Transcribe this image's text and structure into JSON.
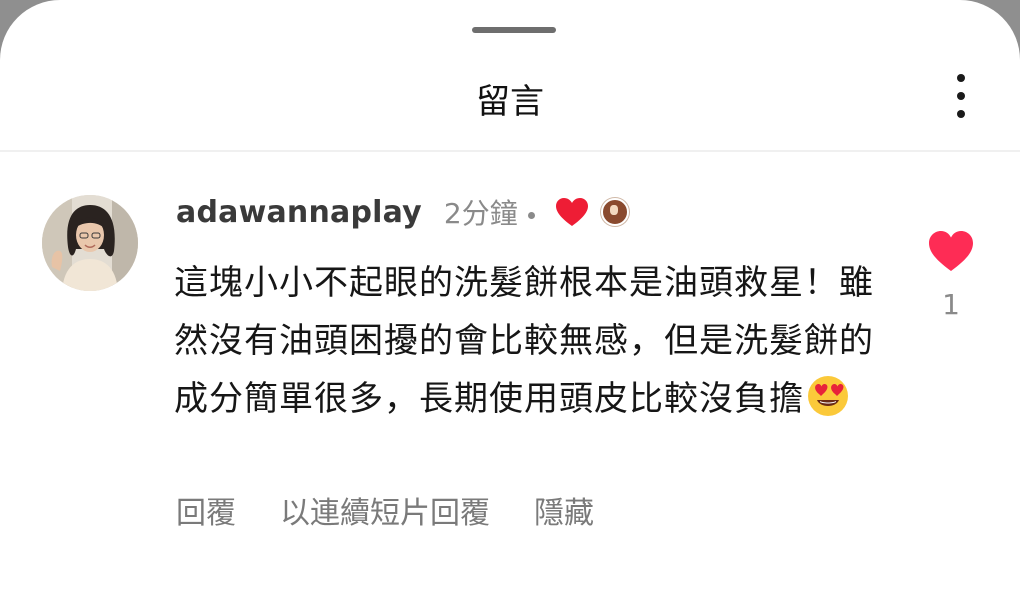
{
  "sheet": {
    "title": "留言"
  },
  "comment": {
    "username": "adawannaplay",
    "timestamp": "2分鐘",
    "text": "這塊小小不起眼的洗髮餅根本是油頭救星！雖然沒有油頭困擾的會比較無感，但是洗髮餅的成分簡單很多，長期使用頭皮比較沒負擔",
    "emoji": "heart-eyes-emoji",
    "like_count": "1",
    "creator_liked": true,
    "actions": {
      "reply": "回覆",
      "video_reply": "以連續短片回覆",
      "hide": "隱藏"
    }
  },
  "colors": {
    "like_red": "#fe2c55",
    "heart_red": "#ee1d35",
    "muted_text": "#8a8a8a",
    "action_text": "#7a7a7a"
  },
  "icons": {
    "more": "more-vertical-icon",
    "like": "heart-icon",
    "creator_like": "creator-heart-icon"
  }
}
